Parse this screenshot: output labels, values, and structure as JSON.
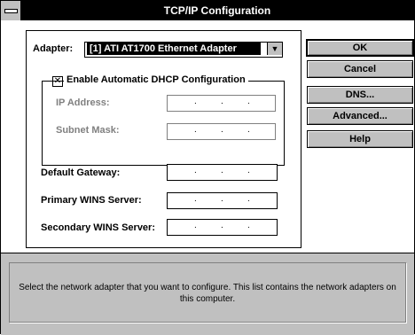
{
  "window": {
    "title": "TCP/IP Configuration"
  },
  "adapter": {
    "label": "Adapter:",
    "selected": "[1] ATI AT1700 Ethernet Adapter"
  },
  "dhcp": {
    "label": "Enable Automatic DHCP Configuration",
    "checked": true,
    "ip_label": "IP Address:",
    "subnet_label": "Subnet Mask:"
  },
  "fields": {
    "gateway_label": "Default Gateway:",
    "primary_wins_label": "Primary WINS Server:",
    "secondary_wins_label": "Secondary WINS Server:"
  },
  "buttons": {
    "ok": "OK",
    "cancel": "Cancel",
    "dns": "DNS...",
    "advanced": "Advanced...",
    "help": "Help"
  },
  "status": {
    "text": "Select the network adapter that you want to configure. This list contains the network adapters on this computer."
  },
  "icons": [
    "system-menu-icon",
    "dropdown-arrow-icon",
    "checkbox-icon"
  ],
  "colors": {
    "titlebar": "#000000",
    "dialog_bg": "#ffffff",
    "button_face": "#c0c0c0",
    "status_bg": "#c0c0c0"
  }
}
